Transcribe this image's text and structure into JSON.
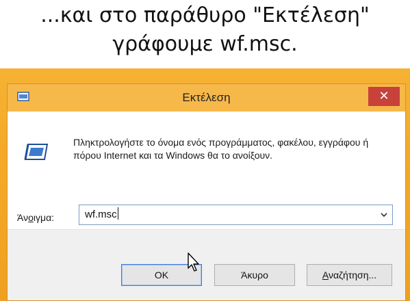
{
  "caption": {
    "line1": "...και στο παράθυρο \"Εκτέλεση\"",
    "line2": "γράφουμε wf.msc."
  },
  "dialog": {
    "title": "Εκτέλεση",
    "close_glyph": "✕",
    "description": "Πληκτρολογήστε το όνομα ενός προγράμματος, φακέλου, εγγράφου ή πόρου Internet και τα Windows θα το ανοίξουν.",
    "open_label_pre": "Άν",
    "open_label_u": "ο",
    "open_label_post": "ιγμα:",
    "open_value": "wf.msc",
    "buttons": {
      "ok": "OK",
      "cancel": "Άκυρο",
      "browse_u": "Α",
      "browse_rest": "ναζήτηση..."
    }
  },
  "icons": {
    "title_icon": "run-app-icon",
    "large_icon": "run-app-icon",
    "dropdown": "chevron-down-icon",
    "pointer": "mouse-pointer-icon"
  },
  "colors": {
    "desktop_accent": "#f4a927",
    "titlebar": "#f7b84a",
    "close_button": "#c7423a",
    "button_band": "#f0f0f0",
    "ok_border": "#3d7bd9"
  }
}
